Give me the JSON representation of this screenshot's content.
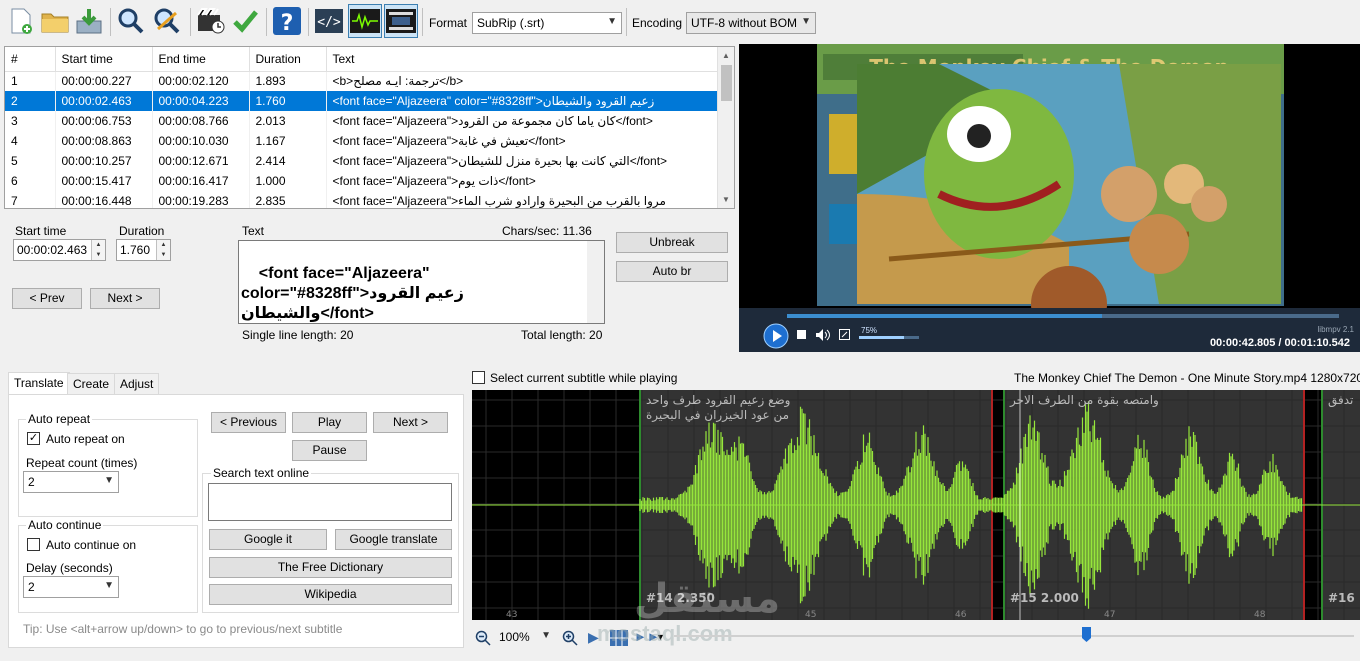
{
  "toolbar": {
    "format_label": "Format",
    "format_value": "SubRip (.srt)",
    "encoding_label": "Encoding",
    "encoding_value": "UTF-8 without BOM"
  },
  "grid": {
    "columns": [
      "#",
      "Start time",
      "End time",
      "Duration",
      "Text"
    ],
    "rows": [
      {
        "num": "1",
        "start": "00:00:00.227",
        "end": "00:00:02.120",
        "dur": "1.893",
        "text": "<b>ترجمة: ايـه مصلح</b>"
      },
      {
        "num": "2",
        "start": "00:00:02.463",
        "end": "00:00:04.223",
        "dur": "1.760",
        "text": "<font face=\"Aljazeera\" color=\"#8328ff\">زعيم القرود والشيطان"
      },
      {
        "num": "3",
        "start": "00:00:06.753",
        "end": "00:00:08.766",
        "dur": "2.013",
        "text": "<font face=\"Aljazeera\">كان ياما كان مجموعة من القرود</font>"
      },
      {
        "num": "4",
        "start": "00:00:08.863",
        "end": "00:00:10.030",
        "dur": "1.167",
        "text": "<font face=\"Aljazeera\">تعيش في غابة</font>"
      },
      {
        "num": "5",
        "start": "00:00:10.257",
        "end": "00:00:12.671",
        "dur": "2.414",
        "text": "<font face=\"Aljazeera\">التي كانت بها بحيرة منزل للشيطان</font>"
      },
      {
        "num": "6",
        "start": "00:00:15.417",
        "end": "00:00:16.417",
        "dur": "1.000",
        "text": "<font face=\"Aljazeera\">ذات يوم</font>"
      },
      {
        "num": "7",
        "start": "00:00:16.448",
        "end": "00:00:19.283",
        "dur": "2.835",
        "text": "<font face=\"Aljazeera\">مروا بالقرب من البحيرة وارادو شرب الماء"
      }
    ]
  },
  "edit": {
    "start_label": "Start time",
    "start_value": "00:00:02.463",
    "duration_label": "Duration",
    "duration_value": "1.760",
    "text_label": "Text",
    "chars_sec": "Chars/sec: 11.36",
    "text_value": "<font face=\"Aljazeera\"\ncolor=\"#8328ff\">زعيم القرود\nوالشيطان</font>",
    "single_line": "Single line length: 20",
    "total_length": "Total length: 20",
    "prev": "< Prev",
    "next": "Next >",
    "unbreak": "Unbreak",
    "autobr": "Auto br"
  },
  "video": {
    "title_overlay": "The Monkey Chief & The Demon",
    "volume": "75%",
    "engine": "libmpv 2.1",
    "timecode": "00:00:42.805 / 00:01:10.542"
  },
  "tabs": [
    "Translate",
    "Create",
    "Adjust"
  ],
  "translate": {
    "auto_repeat_title": "Auto repeat",
    "auto_repeat_on": "Auto repeat on",
    "repeat_count_label": "Repeat count (times)",
    "repeat_count_value": "2",
    "auto_continue_title": "Auto continue",
    "auto_continue_on": "Auto continue on",
    "delay_label": "Delay (seconds)",
    "delay_value": "2",
    "previous": "< Previous",
    "play": "Play",
    "next": "Next >",
    "pause": "Pause",
    "search_label": "Search text online",
    "google_it": "Google it",
    "google_translate": "Google translate",
    "free_dictionary": "The Free Dictionary",
    "wikipedia": "Wikipedia",
    "tip": "Tip: Use <alt+arrow up/down> to go to previous/next subtitle"
  },
  "waveform": {
    "select_current": "Select current subtitle while playing",
    "file_info": "The Monkey Chief  The Demon - One Minute Story.mp4 1280x720",
    "sub_left_line1": "وضع زعيم القرود طرف واحد",
    "sub_left_line2": "من عود الخيزران في البحيرة",
    "sub_mid_line1": "وامتصه بقوة من الطرف الاخر",
    "sub_right": "تدفق",
    "label_14": "#14  2.350",
    "label_15": "#15  2.000",
    "label_16": "#16",
    "ticks": [
      "43",
      "45",
      "46",
      "47",
      "48"
    ],
    "zoom": "100%",
    "watermark_ar": "مستقل",
    "watermark_url": "mostaql.com"
  }
}
